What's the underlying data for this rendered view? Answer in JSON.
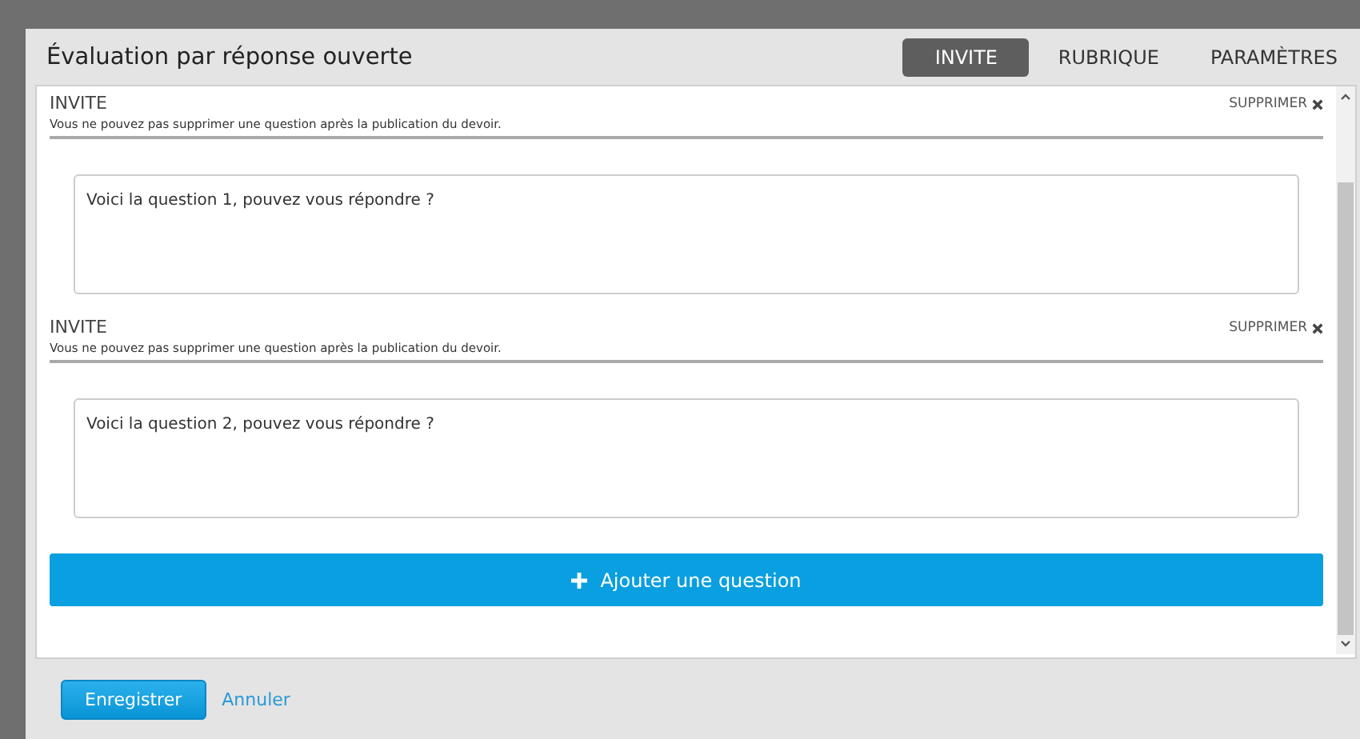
{
  "dialog": {
    "title": "Évaluation par réponse ouverte",
    "tabs": [
      {
        "label": "INVITE",
        "selected": true
      },
      {
        "label": "RUBRIQUE",
        "selected": false
      },
      {
        "label": "PARAMÈTRES",
        "selected": false
      }
    ]
  },
  "questions": [
    {
      "title": "INVITE",
      "note": "Vous ne pouvez pas supprimer une question après la publication du devoir.",
      "delete_label": "SUPPRIMER",
      "text": "Voici la question 1, pouvez vous répondre ?"
    },
    {
      "title": "INVITE",
      "note": "Vous ne pouvez pas supprimer une question après la publication du devoir.",
      "delete_label": "SUPPRIMER",
      "text": "Voici la question 2, pouvez vous répondre ?"
    }
  ],
  "add_button": {
    "label": "Ajouter une question"
  },
  "footer": {
    "save": "Enregistrer",
    "cancel": "Annuler"
  }
}
